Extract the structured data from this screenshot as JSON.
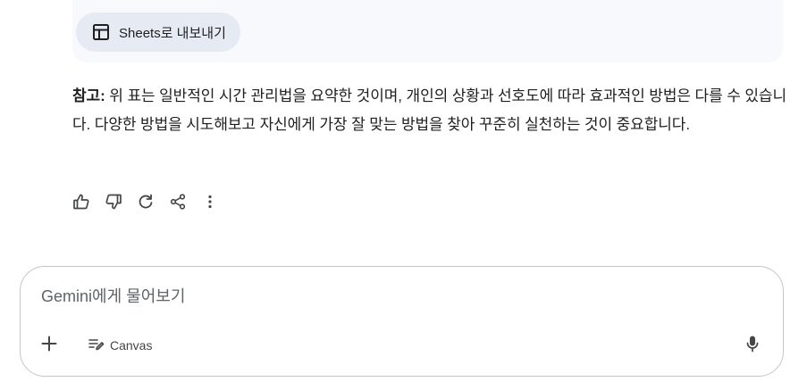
{
  "export": {
    "icon": "table-icon",
    "label": "Sheets로 내보내기"
  },
  "note": {
    "lead": "참고:",
    "body": " 위 표는 일반적인 시간 관리법을 요약한 것이며, 개인의 상황과 선호도에 따라 효과적인 방법은 다를 수 있습니다. 다양한 방법을 시도해보고 자신에게 가장 잘 맞는 방법을 찾아 꾸준히 실천하는 것이 중요합니다."
  },
  "actions": [
    {
      "name": "thumbs-up-icon"
    },
    {
      "name": "thumbs-down-icon"
    },
    {
      "name": "regenerate-icon"
    },
    {
      "name": "share-icon"
    },
    {
      "name": "more-options-icon"
    }
  ],
  "composer": {
    "placeholder": "Gemini에게 물어보기",
    "add_icon": "plus-icon",
    "canvas_icon": "canvas-icon",
    "canvas_label": "Canvas",
    "mic_icon": "microphone-icon"
  },
  "colors": {
    "card_bg": "#f8f9fc",
    "button_bg": "#e6ebf3",
    "text": "#1f1f1f",
    "icon": "#444746",
    "border": "#c4c7c5"
  }
}
